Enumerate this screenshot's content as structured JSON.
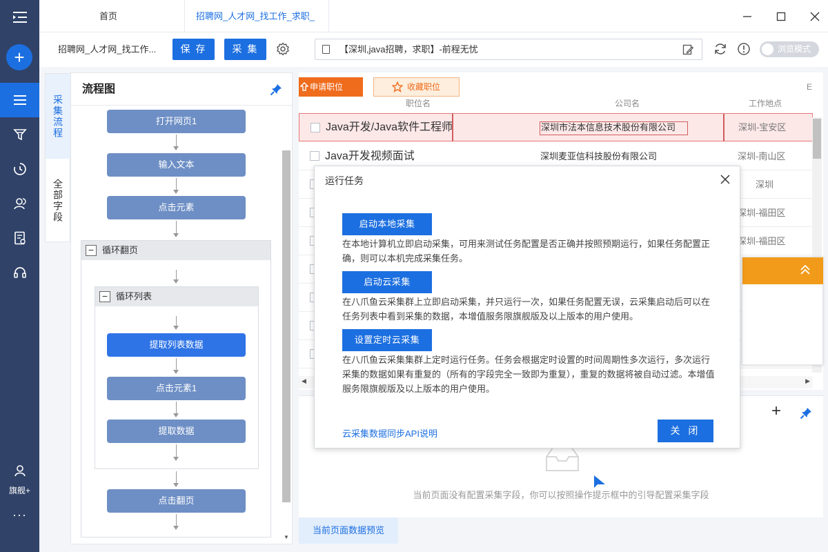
{
  "titlebar": {
    "home_tab": "首页",
    "active_tab": "招聘网_人才网_找工作_求职_"
  },
  "toolbar": {
    "task_title": "招聘网_人才网_找工作...",
    "save_label": "保 存",
    "collect_label": "采 集",
    "url": "【深圳,java招聘，求职】-前程无忧",
    "browse_mode_label": "浏览模式"
  },
  "rail": {
    "account_label": "旗舰+",
    "more_label": "···"
  },
  "side_tabs": {
    "tab1": "采集流程",
    "tab2": "全部字段"
  },
  "flow": {
    "title": "流程图",
    "nodes": {
      "open_page": "打开网页1",
      "input_text": "输入文本",
      "click_element": "点击元素",
      "loop_paging": "循环翻页",
      "loop_list": "循环列表",
      "extract_list": "提取列表数据",
      "click_element1": "点击元素1",
      "extract_data": "提取数据",
      "click_next": "点击翻页"
    }
  },
  "table": {
    "apply_label": "申请职位",
    "fav_label": "收藏职位",
    "col_title": "职位名",
    "col_company": "公司名",
    "col_location": "工作地点",
    "rows": [
      {
        "title": "Java开发/Java软件工程师",
        "company": "深圳市法本信息技术股份有限公司",
        "location": "深圳-宝安区"
      },
      {
        "title": "Java开发视频面试",
        "company": "深圳麦亚信科技股份有限公司",
        "location": "深圳-南山区"
      },
      {
        "title": "",
        "company": "",
        "location": "深圳"
      },
      {
        "title": "",
        "company": "",
        "location": "深圳-福田区"
      },
      {
        "title": "",
        "company": "",
        "location": "深圳-福田区"
      }
    ]
  },
  "fields": {
    "empty_text": "当前页面没有配置采集字段，你可以按照操作提示框中的引导配置采集字段",
    "preview_tab": "当前页面数据预览"
  },
  "modal": {
    "title": "运行任务",
    "local_btn": "启动本地采集",
    "local_desc": "在本地计算机立即启动采集，可用来测试任务配置是否正确并按照预期运行，如果任务配置正确，则可以本机完成采集任务。",
    "cloud_btn": "启动云采集",
    "cloud_desc": "在八爪鱼云采集群上立即启动采集，并只运行一次，如果任务配置无误，云采集启动后可以在任务列表中看到采集的数据，本增值服务限旗舰版及以上版本的用户使用。",
    "schedule_btn": "设置定时云采集",
    "schedule_desc": "在八爪鱼云采集集群上定时运行任务。任务会根据定时设置的时间周期性多次运行，多次运行采集的数据如果有重复的（所有的字段完全一致即为重复），重复的数据将被自动过滤。本增值服务限旗舰版及以上版本的用户使用。",
    "api_link": "云采集数据同步API说明",
    "close_btn": "关 闭"
  },
  "colors": {
    "rail_bg": "#304268",
    "primary": "#1c6fe0",
    "node": "#6e8fc5",
    "orange": "#ef6c1d",
    "selected_row": "#fde8e8"
  }
}
